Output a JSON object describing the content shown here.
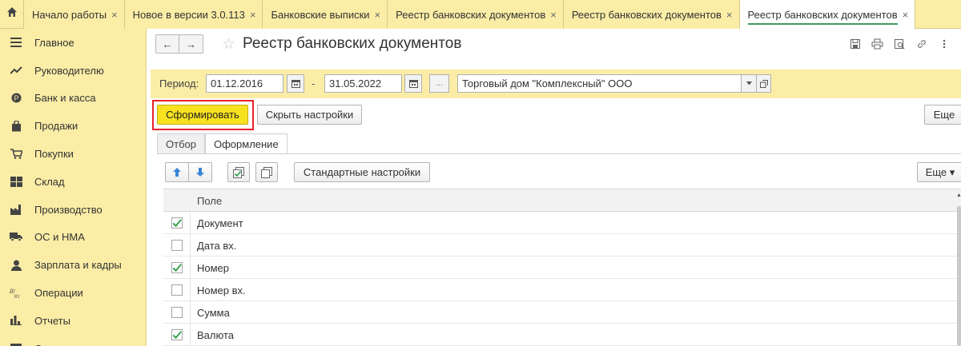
{
  "tabstrip": {
    "home_icon": "home-icon",
    "tabs": [
      {
        "label": "Начало работы",
        "close": "×"
      },
      {
        "label": "Новое в версии 3.0.113",
        "close": "×"
      },
      {
        "label": "Банковские выписки",
        "close": "×"
      },
      {
        "label": "Реестр банковских документов",
        "close": "×"
      },
      {
        "label": "Реестр банковских документов",
        "close": "×"
      },
      {
        "label": "Реестр банковских документов",
        "close": "×",
        "active": true
      }
    ]
  },
  "sidebar": {
    "items": [
      {
        "label": "Главное",
        "icon": "menu-icon"
      },
      {
        "label": "Руководителю",
        "icon": "trend-icon"
      },
      {
        "label": "Банк и касса",
        "icon": "coin-icon"
      },
      {
        "label": "Продажи",
        "icon": "bag-icon"
      },
      {
        "label": "Покупки",
        "icon": "cart-icon"
      },
      {
        "label": "Склад",
        "icon": "warehouse-icon"
      },
      {
        "label": "Производство",
        "icon": "factory-icon"
      },
      {
        "label": "ОС и НМА",
        "icon": "truck-icon"
      },
      {
        "label": "Зарплата и кадры",
        "icon": "person-icon"
      },
      {
        "label": "Операции",
        "icon": "dt-kt-icon"
      },
      {
        "label": "Отчеты",
        "icon": "bar-chart-icon"
      },
      {
        "label": "Справочники",
        "icon": "book-icon"
      }
    ]
  },
  "header": {
    "title": "Реестр банковских документов",
    "back_icon": "←",
    "forward_icon": "→",
    "star": "☆"
  },
  "period": {
    "label": "Период:",
    "from": "01.12.2016",
    "dash": "-",
    "to": "31.05.2022",
    "ellipsis": "...",
    "organization": "Торговый дом \"Комплексный\" ООО"
  },
  "actions": {
    "generate": "Сформировать",
    "hide_settings": "Скрыть настройки",
    "more": "Еще"
  },
  "settings": {
    "tabs": [
      {
        "label": "Отбор"
      },
      {
        "label": "Оформление",
        "active": true
      }
    ],
    "standard_settings": "Стандартные настройки",
    "more": "Еще ▾",
    "column_header": "Поле",
    "fields": [
      {
        "label": "Документ",
        "checked": true
      },
      {
        "label": "Дата вх.",
        "checked": false
      },
      {
        "label": "Номер",
        "checked": true
      },
      {
        "label": "Номер вх.",
        "checked": false
      },
      {
        "label": "Сумма",
        "checked": false
      },
      {
        "label": "Валюта",
        "checked": true
      }
    ]
  },
  "colors": {
    "sidebar_bg": "#fbeda6",
    "accent_yellow": "#f8e21f",
    "highlight_red": "#e8222d",
    "check_green": "#2e9b46"
  }
}
